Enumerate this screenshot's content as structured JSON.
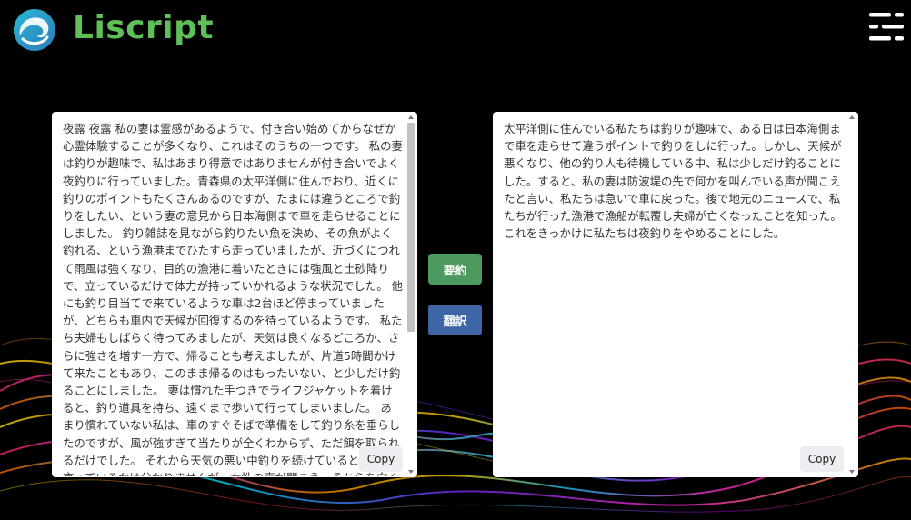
{
  "header": {
    "brand": "Liscript",
    "menu_icon": "hamburger-menu-icon",
    "logo_icon": "liscript-logo-icon"
  },
  "colors": {
    "brand": "#5fbf58",
    "summarize_button": "#4c9a60",
    "translate_button": "#3e66a6",
    "background": "#000000"
  },
  "input_panel": {
    "text": "夜露 夜露 私の妻は霊感があるようで、付き合い始めてからなぜか心霊体験することが多くなり、これはそのうちの一つです。 私の妻は釣りが趣味で、私はあまり得意ではありませんが付き合いでよく夜釣りに行っていました。青森県の太平洋側に住んでおり、近くに釣りのポイントもたくさんあるのですが、たまには違うところで釣りをしたい、という妻の意見から日本海側まで車を走らせることにしました。 釣り雑誌を見ながら釣りたい魚を決め、その魚がよく釣れる、という漁港までひたすら走っていましたが、近づくにつれて雨風は強くなり、目的の漁港に着いたときには強風と土砂降りで、立っているだけで体力が持っていかれるような状況でした。 他にも釣り目当てで来ているような車は2台ほど停まっていましたが、どちらも車内で天候が回復するのを待っているようです。 私たち夫婦もしばらく待ってみましたが、天気は良くなるどころか、さらに強さを増す一方で、帰ることも考えましたが、片道5時間かけて来たこともあり、このまま帰るのはもったいない、と少しだけ釣ることにしました。 妻は慣れた手つきでライフジャケットを着けると、釣り道具を持ち、遠くまで歩いて行ってしまいました。 あまり慣れていない私は、車のすぐそばで準備をして釣り糸を垂らしたのですが、風が強すぎて当たりが全くわからず、ただ餌を取られるだけでした。 それから天気の悪い中釣りを続けていると、何を言っているかは分かりませんが、女性の声が聞こえ、そちらを向くと妻が歩いて来ていました。 やっぱりこの天気だから諦めようと言っているんだな、と解釈し、釣竿を片付けて車に戻りました。 二人で車に乗り込み、その旅行を後にした後の夫婦の会話が以下の通りです。 やっぱり釣れなかったね。こんな天気だとは思わなかった。",
    "copy_label": "Copy"
  },
  "actions": {
    "summarize_label": "要約",
    "translate_label": "翻訳"
  },
  "output_panel": {
    "text": "太平洋側に住んでいる私たちは釣りが趣味で、ある日は日本海側まで車を走らせて違うポイントで釣りをしに行った。しかし、天候が悪くなり、他の釣り人も待機している中、私は少しだけ釣ることにした。すると、私の妻は防波堤の先で何かを叫んでいる声が聞こえたと言い、私たちは急いで車に戻った。後で地元のニュースで、私たちが行った漁港で漁船が転覆し夫婦が亡くなったことを知った。これをきっかけに私たちは夜釣りをやめることにした。",
    "copy_label": "Copy"
  }
}
